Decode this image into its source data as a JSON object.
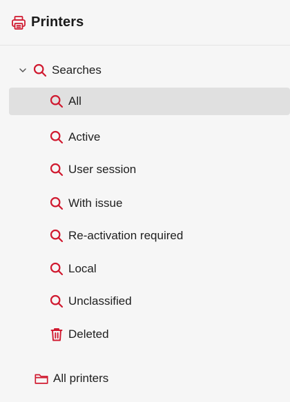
{
  "header": {
    "title": "Printers",
    "icon": "printer-icon"
  },
  "tree": {
    "searches_group": {
      "label": "Searches",
      "expanded": true,
      "icon": "search-icon"
    },
    "search_items": [
      {
        "label": "All",
        "icon": "search-icon",
        "selected": true
      },
      {
        "label": "Active",
        "icon": "search-icon",
        "selected": false
      },
      {
        "label": "User session",
        "icon": "search-icon",
        "selected": false
      },
      {
        "label": "With issue",
        "icon": "search-icon",
        "selected": false
      },
      {
        "label": "Re-activation required",
        "icon": "search-icon",
        "selected": false
      },
      {
        "label": "Local",
        "icon": "search-icon",
        "selected": false
      },
      {
        "label": "Unclassified",
        "icon": "search-icon",
        "selected": false
      },
      {
        "label": "Deleted",
        "icon": "trash-icon",
        "selected": false
      }
    ],
    "folder": {
      "label": "All printers",
      "icon": "folder-icon"
    }
  },
  "colors": {
    "accent": "#d0192f",
    "background": "#f6f6f6",
    "selected_row": "#e0e0e0",
    "text": "#1e1e1e"
  }
}
